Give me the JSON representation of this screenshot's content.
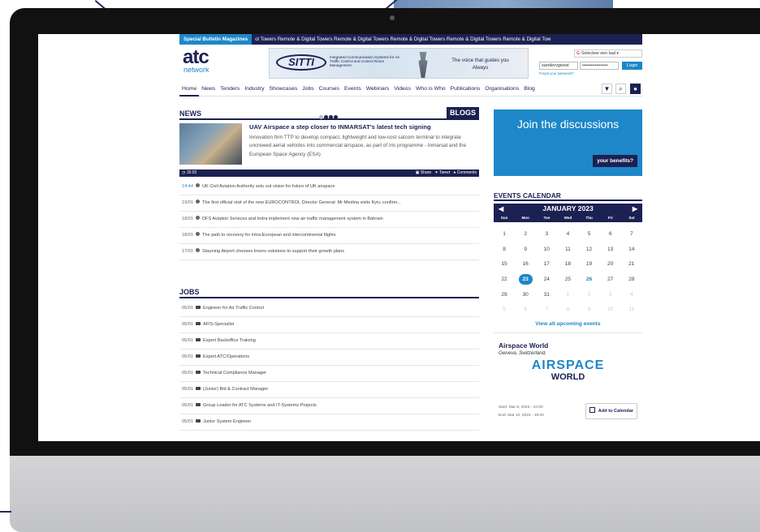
{
  "topbar": {
    "tag": "Special Bulletin Magazines",
    "ticker": "ol Towers   Remote & Digital Towers   Remote & Digital Towers   Remote & Digital Towers   Remote & Digital Towers   Remote & Digital Tow"
  },
  "logo": {
    "line1": "atc",
    "line2": "network"
  },
  "banner": {
    "brand": "SITTI",
    "desc": "Integrated Communication Systems for Air Traffic Control and Control Room Management",
    "voice1": "The voice that guides you",
    "voice2": "Always"
  },
  "header": {
    "language": "Selecteer een taal",
    "username": "sandervgeest",
    "password": "••••••••••••••••••",
    "login": "Login",
    "forgot": "Forgot your password?"
  },
  "nav": {
    "items": [
      "Home",
      "News",
      "Tenders",
      "Industry",
      "Showcases",
      "Jobs",
      "Courses",
      "Events",
      "Webinars",
      "Videos",
      "Who is Who",
      "Publications",
      "Organisations",
      "Blog"
    ]
  },
  "news": {
    "heading": "NEWS",
    "blogs": "BLOGS",
    "feature": {
      "title": "UAV Airspace a step closer to INMARSAT's latest tech signing",
      "excerpt": "Innovation firm TTP to develop compact, lightweight and low-cost satcom terminal to integrate uncrewed aerial vehicles into commercial airspace, as part of Iris programme - Inmarsat and the European Space Agency (ESA)",
      "time": "15:02",
      "share": "Share",
      "tweet": "Tweet",
      "comments": "Comments"
    },
    "items": [
      {
        "time": "14:44",
        "text": "UK Civil Aviation Authority sets out vision for future of UK airspace"
      },
      {
        "time": "19/01",
        "text": "The first official visit of the new EUROCONTROL Director General: Mr Medina visits Kyiv, confirm..."
      },
      {
        "time": "18/01",
        "text": "DFS Aviation Services and Indra implement new air traffic management system in Bahrain"
      },
      {
        "time": "18/01",
        "text": "The path to recovery for intra-European and intercontinental flights"
      },
      {
        "time": "17/01",
        "text": "Stauning Airport chooses Insero solutions to support their growth plans"
      }
    ]
  },
  "jobs": {
    "heading": "JOBS",
    "items": [
      {
        "time": "05/01",
        "text": "Engineer for Air Traffic Control"
      },
      {
        "time": "05/01",
        "text": "AFIS-Specialist"
      },
      {
        "time": "05/01",
        "text": "Expert Backoffice Training"
      },
      {
        "time": "05/01",
        "text": "Expert ATC/Operations"
      },
      {
        "time": "05/01",
        "text": "Technical Compliance Manager"
      },
      {
        "time": "05/01",
        "text": "(Junior) Bid & Contract Manager"
      },
      {
        "time": "05/01",
        "text": "Group Leader for ATC Systems and IT-Systems Projects"
      },
      {
        "time": "05/01",
        "text": "Junior System Engineer"
      }
    ]
  },
  "join": {
    "title": "Join the discussions",
    "button": "your benefits?"
  },
  "calendar": {
    "heading": "EVENTS CALENDAR",
    "month": "JANUARY 2023",
    "dow": [
      "Sun",
      "Mon",
      "Tue",
      "Wed",
      "Thu",
      "Fri",
      "Sat"
    ],
    "days": [
      "1",
      "2",
      "3",
      "4",
      "5",
      "6",
      "7",
      "8",
      "9",
      "10",
      "11",
      "12",
      "13",
      "14",
      "15",
      "16",
      "17",
      "18",
      "19",
      "20",
      "21",
      "22",
      "23",
      "24",
      "25",
      "26",
      "27",
      "28",
      "29",
      "30",
      "31",
      "1",
      "2",
      "3",
      "4",
      "5",
      "6",
      "7",
      "8",
      "9",
      "10",
      "11"
    ],
    "link": "View all upcoming events"
  },
  "event": {
    "name": "Airspace World",
    "location": "Geneva, Switzerland.",
    "logo_top": "AIRSPACE",
    "logo_bottom": "WORLD",
    "start": "Start: Mar 8, 2023 - 10:00",
    "end": "End: Mar 10, 2023 - 18:00",
    "add": "Add to Calendar"
  }
}
